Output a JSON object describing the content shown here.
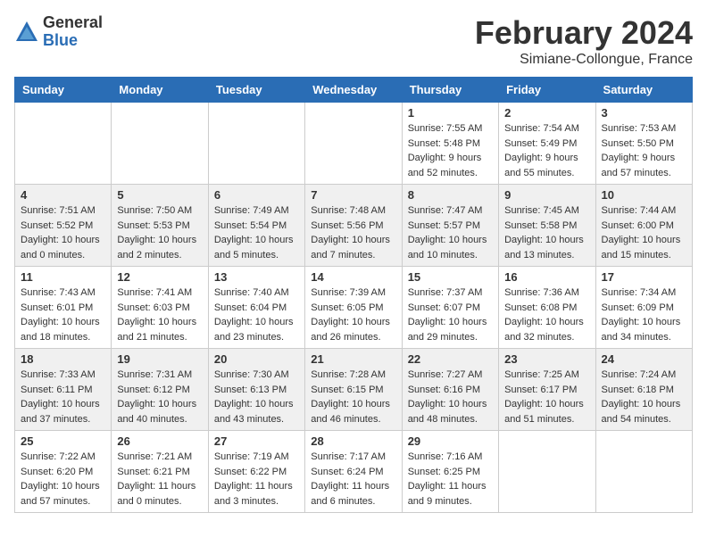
{
  "header": {
    "logo_general": "General",
    "logo_blue": "Blue",
    "month_title": "February 2024",
    "location": "Simiane-Collongue, France"
  },
  "weekdays": [
    "Sunday",
    "Monday",
    "Tuesday",
    "Wednesday",
    "Thursday",
    "Friday",
    "Saturday"
  ],
  "weeks": [
    [
      {
        "day": "",
        "info": ""
      },
      {
        "day": "",
        "info": ""
      },
      {
        "day": "",
        "info": ""
      },
      {
        "day": "",
        "info": ""
      },
      {
        "day": "1",
        "info": "Sunrise: 7:55 AM\nSunset: 5:48 PM\nDaylight: 9 hours\nand 52 minutes."
      },
      {
        "day": "2",
        "info": "Sunrise: 7:54 AM\nSunset: 5:49 PM\nDaylight: 9 hours\nand 55 minutes."
      },
      {
        "day": "3",
        "info": "Sunrise: 7:53 AM\nSunset: 5:50 PM\nDaylight: 9 hours\nand 57 minutes."
      }
    ],
    [
      {
        "day": "4",
        "info": "Sunrise: 7:51 AM\nSunset: 5:52 PM\nDaylight: 10 hours\nand 0 minutes."
      },
      {
        "day": "5",
        "info": "Sunrise: 7:50 AM\nSunset: 5:53 PM\nDaylight: 10 hours\nand 2 minutes."
      },
      {
        "day": "6",
        "info": "Sunrise: 7:49 AM\nSunset: 5:54 PM\nDaylight: 10 hours\nand 5 minutes."
      },
      {
        "day": "7",
        "info": "Sunrise: 7:48 AM\nSunset: 5:56 PM\nDaylight: 10 hours\nand 7 minutes."
      },
      {
        "day": "8",
        "info": "Sunrise: 7:47 AM\nSunset: 5:57 PM\nDaylight: 10 hours\nand 10 minutes."
      },
      {
        "day": "9",
        "info": "Sunrise: 7:45 AM\nSunset: 5:58 PM\nDaylight: 10 hours\nand 13 minutes."
      },
      {
        "day": "10",
        "info": "Sunrise: 7:44 AM\nSunset: 6:00 PM\nDaylight: 10 hours\nand 15 minutes."
      }
    ],
    [
      {
        "day": "11",
        "info": "Sunrise: 7:43 AM\nSunset: 6:01 PM\nDaylight: 10 hours\nand 18 minutes."
      },
      {
        "day": "12",
        "info": "Sunrise: 7:41 AM\nSunset: 6:03 PM\nDaylight: 10 hours\nand 21 minutes."
      },
      {
        "day": "13",
        "info": "Sunrise: 7:40 AM\nSunset: 6:04 PM\nDaylight: 10 hours\nand 23 minutes."
      },
      {
        "day": "14",
        "info": "Sunrise: 7:39 AM\nSunset: 6:05 PM\nDaylight: 10 hours\nand 26 minutes."
      },
      {
        "day": "15",
        "info": "Sunrise: 7:37 AM\nSunset: 6:07 PM\nDaylight: 10 hours\nand 29 minutes."
      },
      {
        "day": "16",
        "info": "Sunrise: 7:36 AM\nSunset: 6:08 PM\nDaylight: 10 hours\nand 32 minutes."
      },
      {
        "day": "17",
        "info": "Sunrise: 7:34 AM\nSunset: 6:09 PM\nDaylight: 10 hours\nand 34 minutes."
      }
    ],
    [
      {
        "day": "18",
        "info": "Sunrise: 7:33 AM\nSunset: 6:11 PM\nDaylight: 10 hours\nand 37 minutes."
      },
      {
        "day": "19",
        "info": "Sunrise: 7:31 AM\nSunset: 6:12 PM\nDaylight: 10 hours\nand 40 minutes."
      },
      {
        "day": "20",
        "info": "Sunrise: 7:30 AM\nSunset: 6:13 PM\nDaylight: 10 hours\nand 43 minutes."
      },
      {
        "day": "21",
        "info": "Sunrise: 7:28 AM\nSunset: 6:15 PM\nDaylight: 10 hours\nand 46 minutes."
      },
      {
        "day": "22",
        "info": "Sunrise: 7:27 AM\nSunset: 6:16 PM\nDaylight: 10 hours\nand 48 minutes."
      },
      {
        "day": "23",
        "info": "Sunrise: 7:25 AM\nSunset: 6:17 PM\nDaylight: 10 hours\nand 51 minutes."
      },
      {
        "day": "24",
        "info": "Sunrise: 7:24 AM\nSunset: 6:18 PM\nDaylight: 10 hours\nand 54 minutes."
      }
    ],
    [
      {
        "day": "25",
        "info": "Sunrise: 7:22 AM\nSunset: 6:20 PM\nDaylight: 10 hours\nand 57 minutes."
      },
      {
        "day": "26",
        "info": "Sunrise: 7:21 AM\nSunset: 6:21 PM\nDaylight: 11 hours\nand 0 minutes."
      },
      {
        "day": "27",
        "info": "Sunrise: 7:19 AM\nSunset: 6:22 PM\nDaylight: 11 hours\nand 3 minutes."
      },
      {
        "day": "28",
        "info": "Sunrise: 7:17 AM\nSunset: 6:24 PM\nDaylight: 11 hours\nand 6 minutes."
      },
      {
        "day": "29",
        "info": "Sunrise: 7:16 AM\nSunset: 6:25 PM\nDaylight: 11 hours\nand 9 minutes."
      },
      {
        "day": "",
        "info": ""
      },
      {
        "day": "",
        "info": ""
      }
    ]
  ]
}
